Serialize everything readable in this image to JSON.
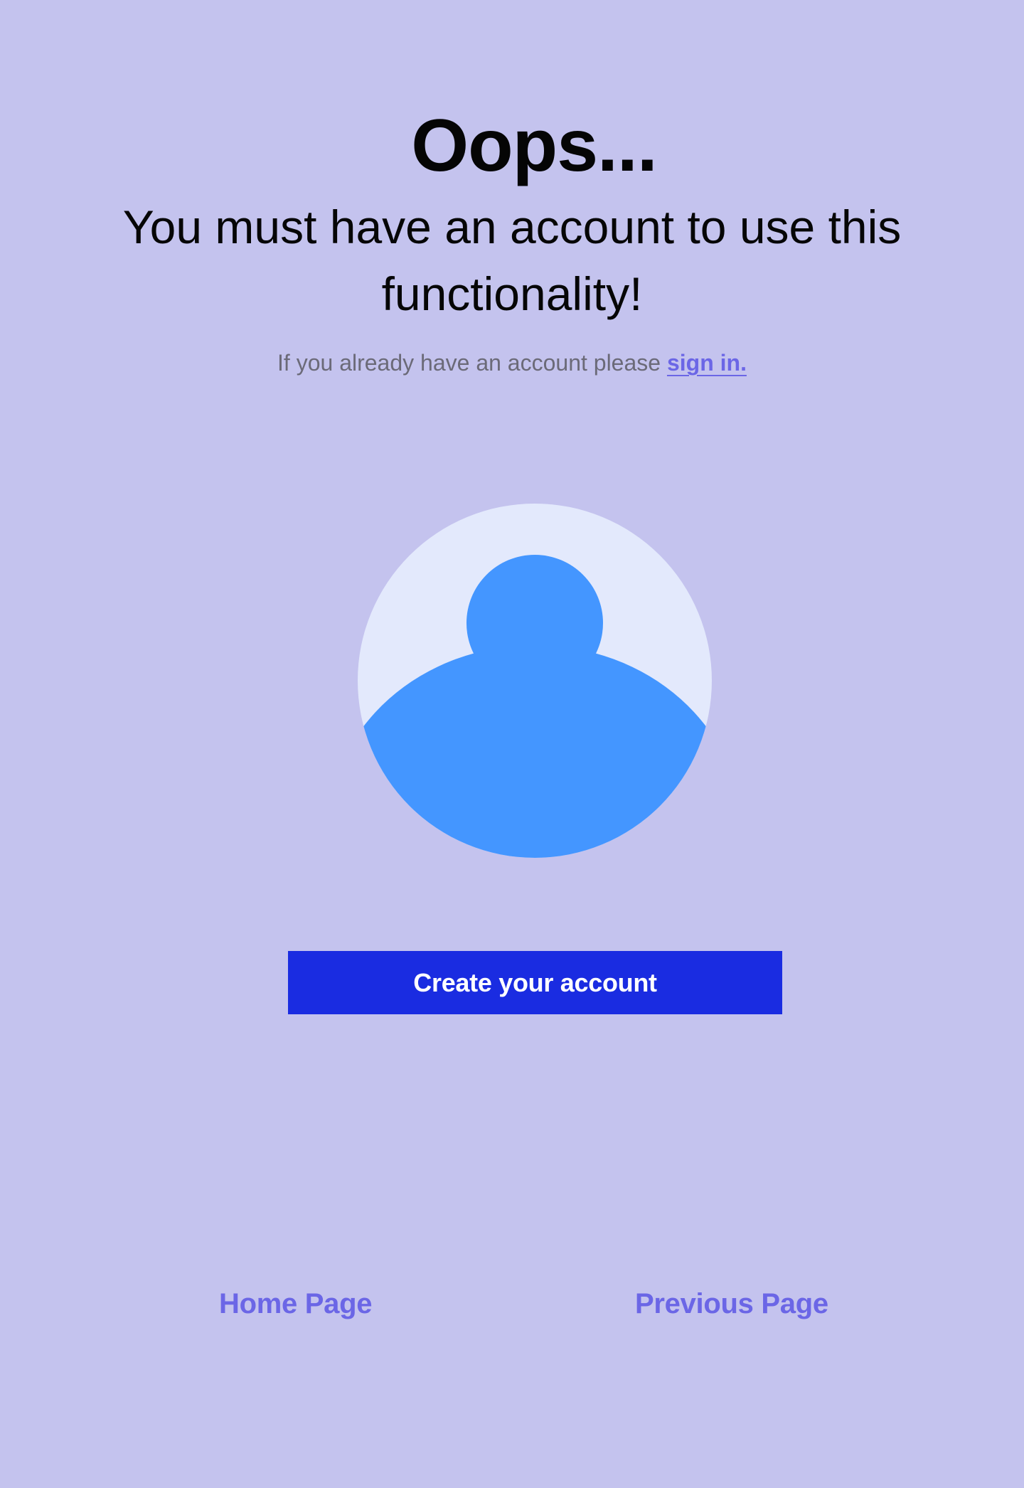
{
  "header": {
    "title": "Oops...",
    "subtitle": "You must have an account to use this functionality!"
  },
  "signin": {
    "prompt": "If you already have an account please ",
    "link_label": "sign in."
  },
  "avatar": {
    "icon": "user-avatar-icon",
    "colors": {
      "circle_bg": "#e3e9fc",
      "figure": "#4496ff"
    }
  },
  "cta": {
    "label": "Create your account",
    "color": "#1a2ce1"
  },
  "footer_nav": {
    "home_label": "Home Page",
    "previous_label": "Previous Page",
    "color": "#6b66e6"
  },
  "colors": {
    "background": "#c4c3ee",
    "text_primary": "#050505",
    "text_muted": "#6b6a78"
  }
}
